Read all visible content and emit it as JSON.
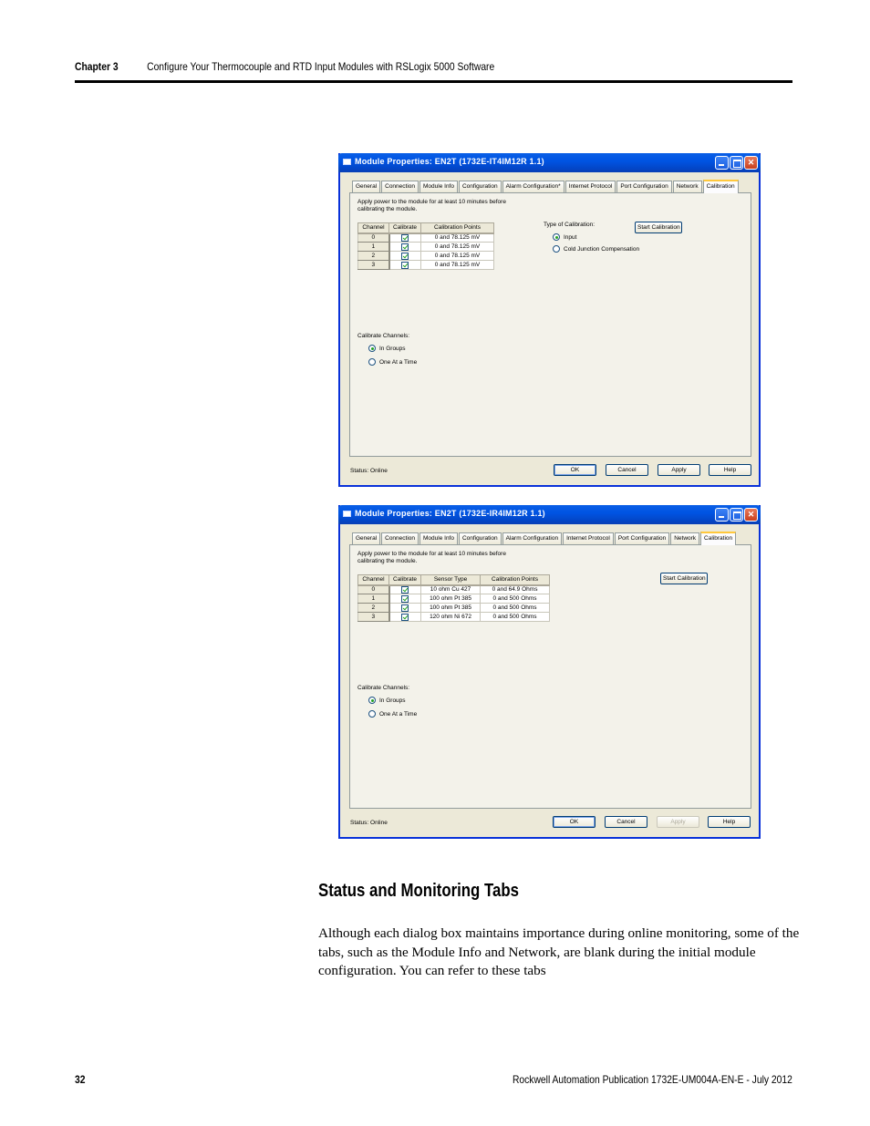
{
  "page_header": {
    "chapter": "Chapter 3",
    "title": "Configure Your Thermocouple and RTD Input Modules with RSLogix 5000 Software"
  },
  "dialogs": [
    {
      "title": "Module Properties: EN2T (1732E-IT4IM12R 1.1)",
      "tabs": [
        "General",
        "Connection",
        "Module Info",
        "Configuration",
        "Alarm Configuration*",
        "Internet Protocol",
        "Port Configuration",
        "Network",
        "Calibration"
      ],
      "active_tab": "Calibration",
      "note": "Apply power to the module for at least 10 minutes before calibrating the module.",
      "table": {
        "headers": [
          "Channel",
          "Calibrate",
          "Calibration Points"
        ],
        "rows": [
          {
            "channel": "0",
            "calibrate": true,
            "points": "0 and 78.125 mV"
          },
          {
            "channel": "1",
            "calibrate": true,
            "points": "0 and 78.125 mV"
          },
          {
            "channel": "2",
            "calibrate": true,
            "points": "0 and 78.125 mV"
          },
          {
            "channel": "3",
            "calibrate": true,
            "points": "0 and 78.125 mV"
          }
        ]
      },
      "type_of_calibration": {
        "label": "Type of Calibration:",
        "options": [
          {
            "label": "Input",
            "selected": true
          },
          {
            "label": "Cold Junction Compensation",
            "selected": false
          }
        ]
      },
      "start_calibration": "Start Calibration",
      "calibrate_channels": {
        "label": "Calibrate Channels:",
        "options": [
          {
            "label": "In Groups",
            "selected": true
          },
          {
            "label": "One At a Time",
            "selected": false
          }
        ]
      },
      "status": "Status:  Online",
      "buttons": {
        "ok": "OK",
        "cancel": "Cancel",
        "apply": "Apply",
        "help": "Help",
        "apply_enabled": true
      }
    },
    {
      "title": "Module Properties: EN2T (1732E-IR4IM12R 1.1)",
      "tabs": [
        "General",
        "Connection",
        "Module Info",
        "Configuration",
        "Alarm Configuration",
        "Internet Protocol",
        "Port Configuration",
        "Network",
        "Calibration"
      ],
      "active_tab": "Calibration",
      "note": "Apply power to the module for at least 10 minutes before calibrating the module.",
      "table": {
        "headers": [
          "Channel",
          "Calibrate",
          "Sensor Type",
          "Calibration Points"
        ],
        "rows": [
          {
            "channel": "0",
            "calibrate": true,
            "sensor": "10 ohm Cu 427",
            "points": "0 and 64.9 Ohms"
          },
          {
            "channel": "1",
            "calibrate": true,
            "sensor": "100 ohm Pt 385",
            "points": "0 and 500 Ohms"
          },
          {
            "channel": "2",
            "calibrate": true,
            "sensor": "100 ohm Pt 385",
            "points": "0 and 500 Ohms"
          },
          {
            "channel": "3",
            "calibrate": true,
            "sensor": "120 ohm Ni 672",
            "points": "0 and 500 Ohms"
          }
        ]
      },
      "start_calibration": "Start Calibration",
      "calibrate_channels": {
        "label": "Calibrate Channels:",
        "options": [
          {
            "label": "In Groups",
            "selected": true
          },
          {
            "label": "One At a Time",
            "selected": false
          }
        ]
      },
      "status": "Status:  Online",
      "buttons": {
        "ok": "OK",
        "cancel": "Cancel",
        "apply": "Apply",
        "help": "Help",
        "apply_enabled": false
      }
    }
  ],
  "section": {
    "title": "Status and Monitoring Tabs",
    "body": "Although each dialog box maintains importance during online monitoring, some of the tabs, such as the Module Info and Network, are blank during the initial module configuration. You can refer to these tabs"
  },
  "footer": {
    "page_number": "32",
    "publication": "Rockwell Automation Publication 1732E-UM004A-EN-E - July 2012"
  }
}
